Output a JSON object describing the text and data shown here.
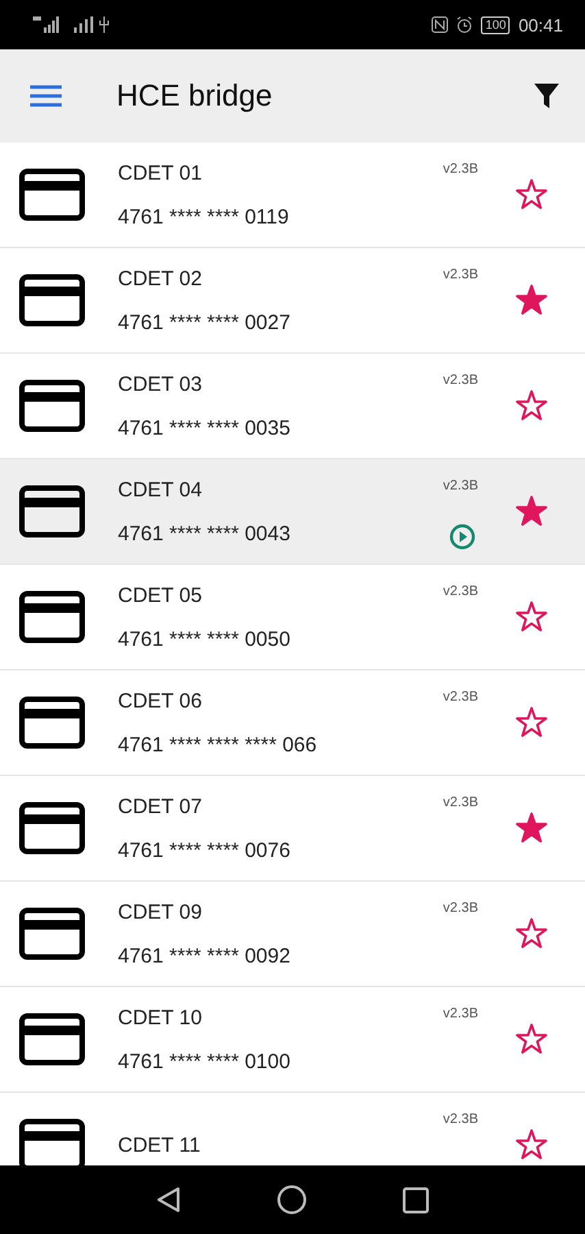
{
  "status_bar": {
    "time": "00:41",
    "battery": "100"
  },
  "toolbar": {
    "title": "HCE bridge"
  },
  "cards": [
    {
      "name": "CDET 01",
      "number": "4761 **** **** 0119",
      "version": "v2.3B",
      "favorite": false,
      "selected": false,
      "active": false
    },
    {
      "name": "CDET 02",
      "number": "4761 **** **** 0027",
      "version": "v2.3B",
      "favorite": true,
      "selected": false,
      "active": false
    },
    {
      "name": "CDET 03",
      "number": "4761 **** **** 0035",
      "version": "v2.3B",
      "favorite": false,
      "selected": false,
      "active": false
    },
    {
      "name": "CDET 04",
      "number": "4761 **** **** 0043",
      "version": "v2.3B",
      "favorite": true,
      "selected": true,
      "active": true
    },
    {
      "name": "CDET 05",
      "number": "4761 **** **** 0050",
      "version": "v2.3B",
      "favorite": false,
      "selected": false,
      "active": false
    },
    {
      "name": "CDET 06",
      "number": "4761 **** **** **** 066",
      "version": "v2.3B",
      "favorite": false,
      "selected": false,
      "active": false
    },
    {
      "name": "CDET 07",
      "number": "4761 **** **** 0076",
      "version": "v2.3B",
      "favorite": true,
      "selected": false,
      "active": false
    },
    {
      "name": "CDET 09",
      "number": "4761 **** **** 0092",
      "version": "v2.3B",
      "favorite": false,
      "selected": false,
      "active": false
    },
    {
      "name": "CDET 10",
      "number": "4761 **** **** 0100",
      "version": "v2.3B",
      "favorite": false,
      "selected": false,
      "active": false
    },
    {
      "name": "CDET 11",
      "version": "v2.3B",
      "favorite": false,
      "selected": false,
      "active": false
    }
  ]
}
